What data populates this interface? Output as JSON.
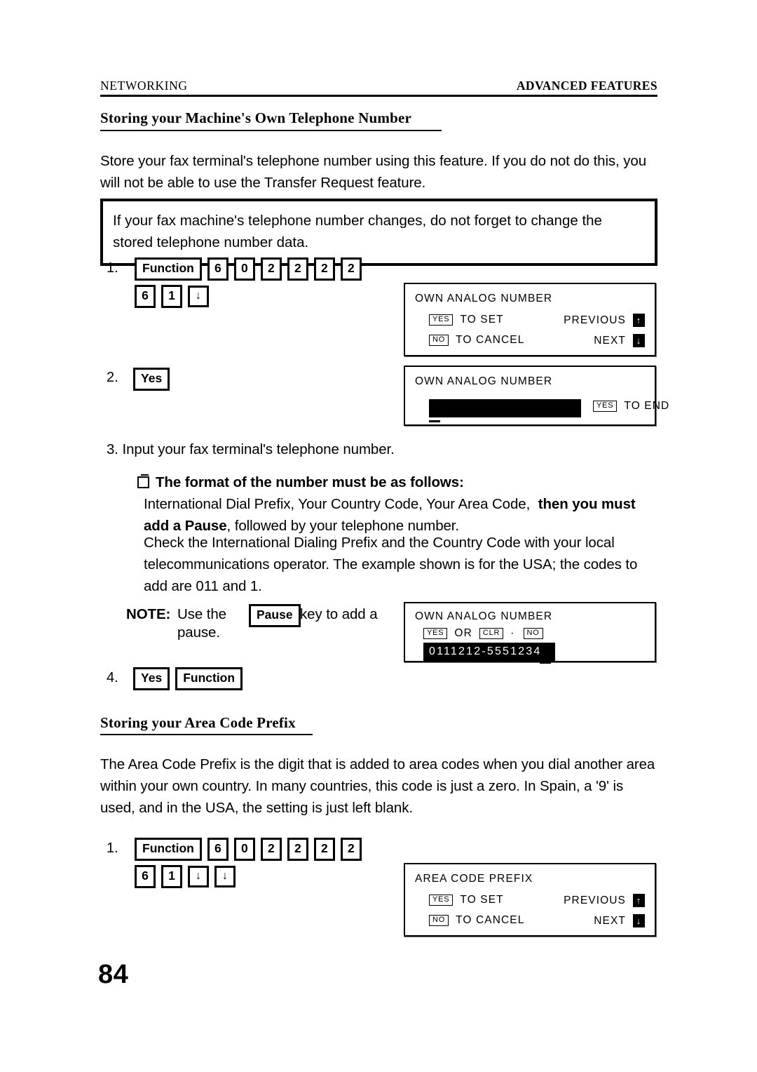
{
  "header": {
    "left": "NETWORKING",
    "right": "ADVANCED FEATURES"
  },
  "section1": {
    "heading": "Storing your Machine's Own Telephone Number",
    "intro": "Store your fax terminal's telephone number using this feature. If you do not do this, you will not be able to use the Transfer Request feature.",
    "callout": "If your fax machine's telephone number changes, do not forget to change the stored telephone number data.",
    "step1": {
      "number": "1.",
      "keys_row1": [
        "Function",
        "6",
        "0",
        "2",
        "2",
        "2",
        "2"
      ],
      "keys_row2": [
        "6",
        "1",
        "↓"
      ]
    },
    "step2": {
      "number": "2.",
      "keys": [
        "Yes"
      ]
    },
    "step3": {
      "number": "3.",
      "text": "Input your fax terminal's telephone number.",
      "bullet_heading": "The format of the number must be as follows:",
      "body_1a": "International Dial Prefix, Your Country Code, Your Area Code,",
      "body_1b": "then you",
      "body_2a": "must add a Pause",
      "body_2b": ", followed by your telephone number.",
      "body_3": "Check the International Dialing Prefix and the Country Code with your local telecommunications operator. The example shown is for the USA; the codes to add are 011 and 1."
    },
    "note": {
      "label": "NOTE:",
      "text_before": "Use the",
      "key": "Pause",
      "text_after": "key to add a",
      "text_line2": "pause."
    },
    "step4": {
      "number": "4.",
      "keys": [
        "Yes",
        "Function"
      ]
    }
  },
  "section2": {
    "heading": "Storing your Area Code Prefix",
    "intro": "The Area Code Prefix is the digit that is added to area codes when you dial another area within your own country. In many countries, this code is just a zero. In Spain, a '9' is used, and in the USA, the setting is just left blank.",
    "step1": {
      "number": "1.",
      "keys_row1": [
        "Function",
        "6",
        "0",
        "2",
        "2",
        "2",
        "2"
      ],
      "keys_row2": [
        "6",
        "1",
        "↓",
        "↓"
      ]
    }
  },
  "lcd1": {
    "title": "OWN ANALOG NUMBER",
    "row1_key": "YES",
    "row1_label": "TO SET",
    "row1_right": "PREVIOUS",
    "row1_arrow": "↑",
    "row2_key": "NO",
    "row2_label": "TO CANCEL",
    "row2_right": "NEXT",
    "row2_arrow": "↓"
  },
  "lcd2": {
    "title": "OWN ANALOG NUMBER",
    "value": "",
    "key": "YES",
    "label": "TO END"
  },
  "lcd3": {
    "title": "OWN ANALOG NUMBER",
    "key1": "YES",
    "conj": "OR",
    "key2": "CLR",
    "dot": "·",
    "key3": "NO",
    "value": "0111212-5551234"
  },
  "lcd4": {
    "title": "AREA CODE PREFIX",
    "row1_key": "YES",
    "row1_label": "TO SET",
    "row1_right": "PREVIOUS",
    "row1_arrow": "↑",
    "row2_key": "NO",
    "row2_label": "TO CANCEL",
    "row2_right": "NEXT",
    "row2_arrow": "↓"
  },
  "page_number": "84"
}
